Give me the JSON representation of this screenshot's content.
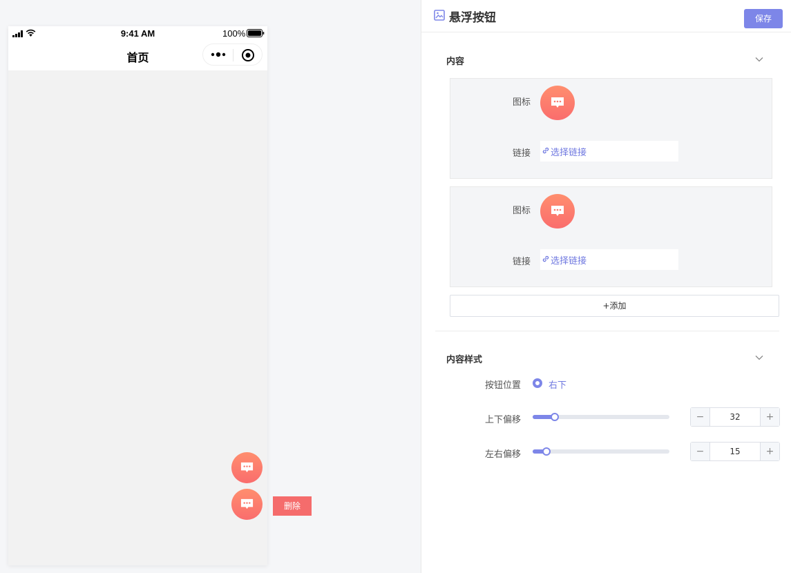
{
  "statusbar": {
    "time": "9:41 AM",
    "battery": "100%"
  },
  "page": {
    "title": "首页"
  },
  "preview": {
    "delete_label": "删除"
  },
  "panel": {
    "title": "悬浮按钮",
    "save_label": "保存",
    "content_section": {
      "title": "内容",
      "items": [
        {
          "icon_label": "图标",
          "link_label": "链接",
          "link_placeholder": "选择链接"
        },
        {
          "icon_label": "图标",
          "link_label": "链接",
          "link_placeholder": "选择链接"
        }
      ],
      "add_label": "+添加"
    },
    "style_section": {
      "title": "内容样式",
      "position_label": "按钮位置",
      "position_value": "右下",
      "vertical_offset_label": "上下偏移",
      "vertical_offset": "32",
      "horizontal_offset_label": "左右偏移",
      "horizontal_offset": "15"
    }
  },
  "colors": {
    "accent": "#7d86e8",
    "float_button": "#fa6d6d",
    "delete": "#f56c6c"
  },
  "icons": [
    "signal-icon",
    "wifi-icon",
    "battery-icon",
    "more-icon",
    "target-icon",
    "chat-icon",
    "image-icon",
    "chevron-down-icon",
    "link-icon"
  ]
}
